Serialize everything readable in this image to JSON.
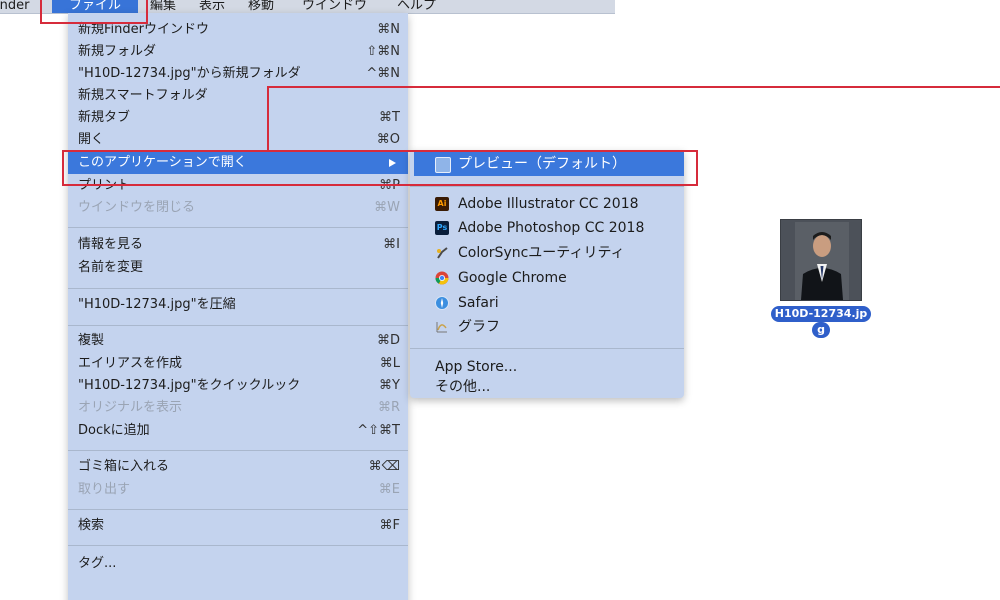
{
  "menubar": {
    "app_name": "inder",
    "items": [
      "ファイル",
      "編集",
      "表示",
      "移動",
      "ウインドウ",
      "ヘルプ"
    ]
  },
  "file_menu": {
    "new_finder_window": {
      "label": "新規Finderウインドウ",
      "shortcut": "⌘N"
    },
    "new_folder": {
      "label": "新規フォルダ",
      "shortcut": "⇧⌘N"
    },
    "new_folder_from": {
      "label": "\"H10D-12734.jpg\"から新規フォルダ",
      "shortcut": "^⌘N"
    },
    "new_smart_folder": {
      "label": "新規スマートフォルダ",
      "shortcut": ""
    },
    "new_tab": {
      "label": "新規タブ",
      "shortcut": "⌘T"
    },
    "open": {
      "label": "開く",
      "shortcut": "⌘O"
    },
    "open_with": {
      "label": "このアプリケーションで開く",
      "shortcut": ""
    },
    "print": {
      "label": "プリント",
      "shortcut": "⌘P"
    },
    "close_window": {
      "label": "ウインドウを閉じる",
      "shortcut": "⌘W"
    },
    "get_info": {
      "label": "情報を見る",
      "shortcut": "⌘I"
    },
    "rename": {
      "label": "名前を変更",
      "shortcut": ""
    },
    "compress": {
      "label": "\"H10D-12734.jpg\"を圧縮",
      "shortcut": ""
    },
    "duplicate": {
      "label": "複製",
      "shortcut": "⌘D"
    },
    "make_alias": {
      "label": "エイリアスを作成",
      "shortcut": "⌘L"
    },
    "quick_look": {
      "label": "\"H10D-12734.jpg\"をクイックルック",
      "shortcut": "⌘Y"
    },
    "show_original": {
      "label": "オリジナルを表示",
      "shortcut": "⌘R"
    },
    "add_to_dock": {
      "label": "Dockに追加",
      "shortcut": "^⇧⌘T"
    },
    "move_to_trash": {
      "label": "ゴミ箱に入れる",
      "shortcut": "⌘⌫"
    },
    "eject": {
      "label": "取り出す",
      "shortcut": "⌘E"
    },
    "find": {
      "label": "検索",
      "shortcut": "⌘F"
    },
    "tags": {
      "label": "タグ..."
    },
    "tag_colors": [
      "#e8524a",
      "#f2a33a",
      "#f5d23b",
      "#62c554",
      "#4aa7f0",
      "#b57edc",
      "#9b9b9b"
    ]
  },
  "submenu": {
    "preview": {
      "label": "プレビュー（デフォルト）",
      "icon": "preview-icon"
    },
    "illustrator": {
      "label": "Adobe Illustrator CC 2018",
      "icon": "illustrator-icon",
      "icon_text": "Ai"
    },
    "photoshop": {
      "label": "Adobe Photoshop CC 2018",
      "icon": "photoshop-icon",
      "icon_text": "Ps"
    },
    "colorsync": {
      "label": "ColorSyncユーティリティ",
      "icon": "colorsync-icon"
    },
    "chrome": {
      "label": "Google Chrome",
      "icon": "chrome-icon"
    },
    "safari": {
      "label": "Safari",
      "icon": "safari-icon"
    },
    "grapher": {
      "label": "グラフ",
      "icon": "grapher-icon"
    },
    "app_store": {
      "label": "App Store..."
    },
    "other": {
      "label": "その他..."
    }
  },
  "desktop_file": {
    "name_line1": "H10D-12734.jp",
    "name_line2": "g"
  },
  "colors": {
    "highlight": "#3b78dc",
    "menu_bg": "#c4d3ee",
    "annotation_red": "#d62b3b"
  }
}
